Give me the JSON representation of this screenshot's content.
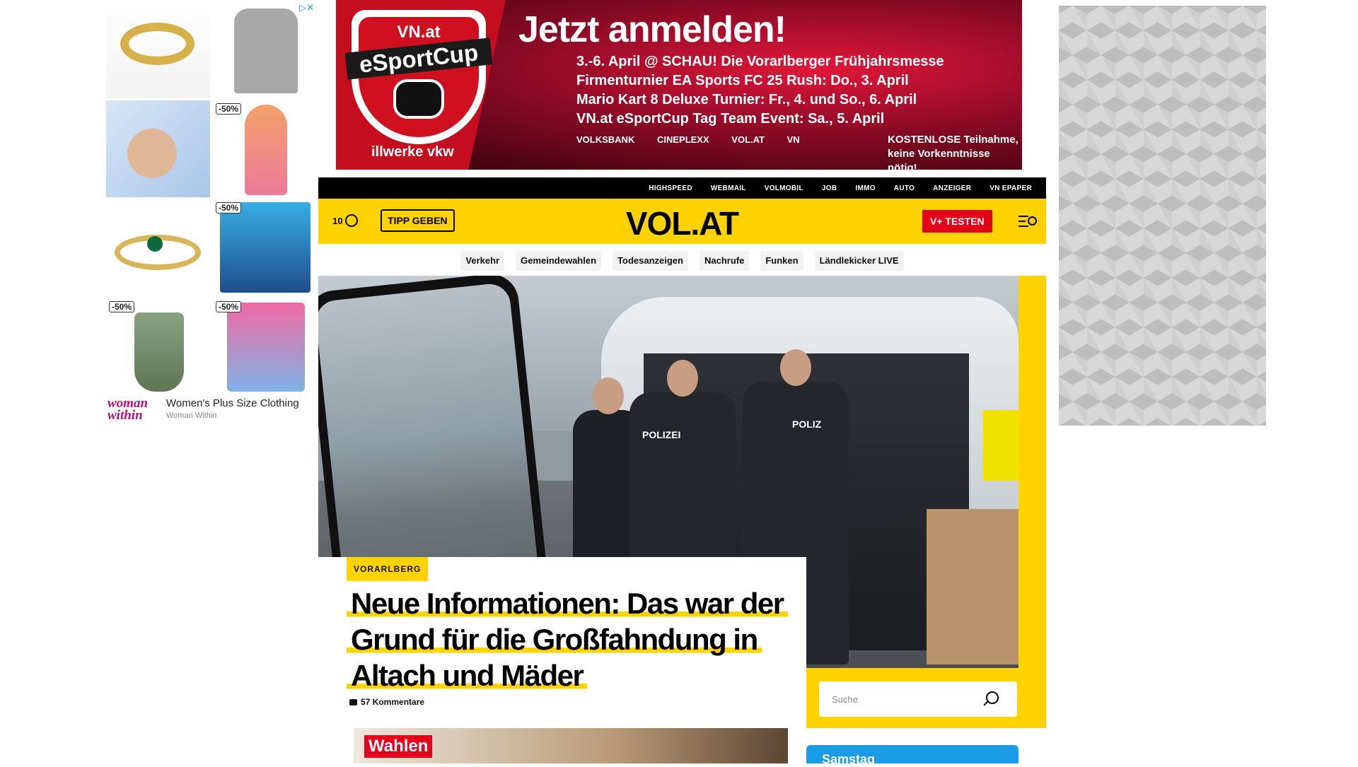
{
  "left_ad": {
    "choices_icon": "adchoices-icon",
    "badges": [
      "-50%",
      "-50%",
      "-50%",
      "-50%"
    ],
    "brand": "woman within",
    "title": "Women's Plus Size Clothing",
    "subtitle": "Woman Within"
  },
  "banner": {
    "logo_top": "VN.at",
    "logo_name": "eSportCup",
    "headline": "Jetzt anmelden!",
    "lines": [
      "3.-6. April @ SCHAU! Die Vorarlberger Frühjahrsmesse",
      "Firmenturnier EA Sports FC 25 Rush: Do., 3. April",
      "Mario Kart 8 Deluxe Turnier: Fr., 4. und So., 6. April",
      "VN.at eSportCup Tag Team Event: Sa., 5. April"
    ],
    "sponsor": "illwerke vkw",
    "partners": [
      "VOLKSBANK",
      "CINEPLEXX",
      "VOL.AT",
      "VN"
    ],
    "free_line1": "KOSTENLOSE Teilnahme,",
    "free_line2": "keine Vorkenntnisse nötig!"
  },
  "topbar": {
    "links": [
      "HIGHSPEED",
      "WEBMAIL",
      "VOLMOBIL",
      "JOB",
      "IMMO",
      "AUTO",
      "ANZEIGER",
      "VN EPAPER"
    ]
  },
  "header": {
    "temperature": "10",
    "tipp_button": "TIPP GEBEN",
    "logo": "VOL.AT",
    "vplus_button": "V+ TESTEN",
    "menu_icon": "menu-search-icon"
  },
  "nav": {
    "pills": [
      "Verkehr",
      "Gemeindewahlen",
      "Todesanzeigen",
      "Nachrufe",
      "Funken",
      "Ländlekicker LIVE"
    ]
  },
  "hero": {
    "badge_left": "POLIZEI",
    "badge_right": "POLIZ"
  },
  "article": {
    "category": "VORARLBERG",
    "headline": "Neue Informationen: Das war der Grund für die Großfahndung in Altach und Mäder",
    "comments": "57 Kommentare"
  },
  "search": {
    "placeholder": "Suche"
  },
  "second_article": {
    "badge": "Wahlen"
  },
  "weather_widget": {
    "day": "Samstag"
  },
  "colors": {
    "brand_yellow": "#ffd200",
    "accent_red": "#e2001a",
    "black": "#000000"
  }
}
